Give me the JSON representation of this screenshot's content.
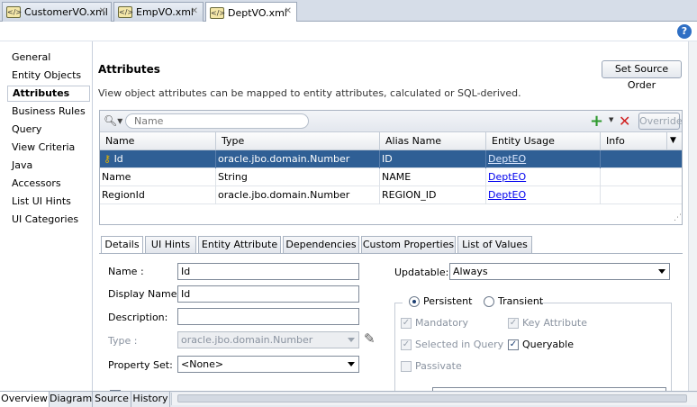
{
  "file_tabs": [
    {
      "label": "CustomerVO.xml",
      "icon": "xml-file-icon"
    },
    {
      "label": "EmpVO.xml",
      "icon": "xml-file-icon"
    },
    {
      "label": "DeptVO.xml",
      "icon": "xml-file-icon",
      "active": true
    }
  ],
  "help_icon": "?",
  "nav": {
    "items": [
      "General",
      "Entity Objects",
      "Attributes",
      "Business Rules",
      "Query",
      "View Criteria",
      "Java",
      "Accessors",
      "List UI Hints",
      "UI Categories"
    ],
    "selected": "Attributes"
  },
  "main": {
    "title": "Attributes",
    "set_source_order": "Set Source Order",
    "description": "View object attributes can be mapped to entity attributes, calculated or SQL-derived.",
    "search_placeholder": "Name",
    "override_label": "Override"
  },
  "table": {
    "columns": [
      "Name",
      "Type",
      "Alias Name",
      "Entity Usage",
      "Info"
    ],
    "rows": [
      {
        "name": "Id",
        "type": "oracle.jbo.domain.Number",
        "alias": "ID",
        "usage": "DeptEO",
        "info": "",
        "key": true,
        "selected": true
      },
      {
        "name": "Name",
        "type": "String",
        "alias": "NAME",
        "usage": "DeptEO",
        "info": ""
      },
      {
        "name": "RegionId",
        "type": "oracle.jbo.domain.Number",
        "alias": "REGION_ID",
        "usage": "DeptEO",
        "info": ""
      }
    ]
  },
  "subtabs": [
    "Details",
    "UI Hints",
    "Entity Attribute",
    "Dependencies",
    "Custom Properties",
    "List of Values"
  ],
  "details": {
    "name_label": "Name :",
    "name_value": "Id",
    "display_name_label": "Display Name:",
    "display_name_value": "Id",
    "description_label": "Description:",
    "description_value": "",
    "type_label": "Type :",
    "type_value": "oracle.jbo.domain.Number",
    "property_set_label": "Property Set:",
    "property_set_value": "<None>",
    "updatable_label": "Updatable:",
    "updatable_value": "Always",
    "persistent": "Persistent",
    "transient": "Transient",
    "mandatory": "Mandatory",
    "key_attribute": "Key Attribute",
    "selected_in_query": "Selected in Query",
    "queryable": "Queryable",
    "passivate": "Passivate"
  },
  "bottom_tabs": [
    "Overview",
    "Diagram",
    "Source",
    "History"
  ],
  "colors": {
    "selection": "#2f5f95",
    "add_green": "#2e9a2e",
    "delete_red": "#d02020",
    "link": "#0000ee"
  }
}
